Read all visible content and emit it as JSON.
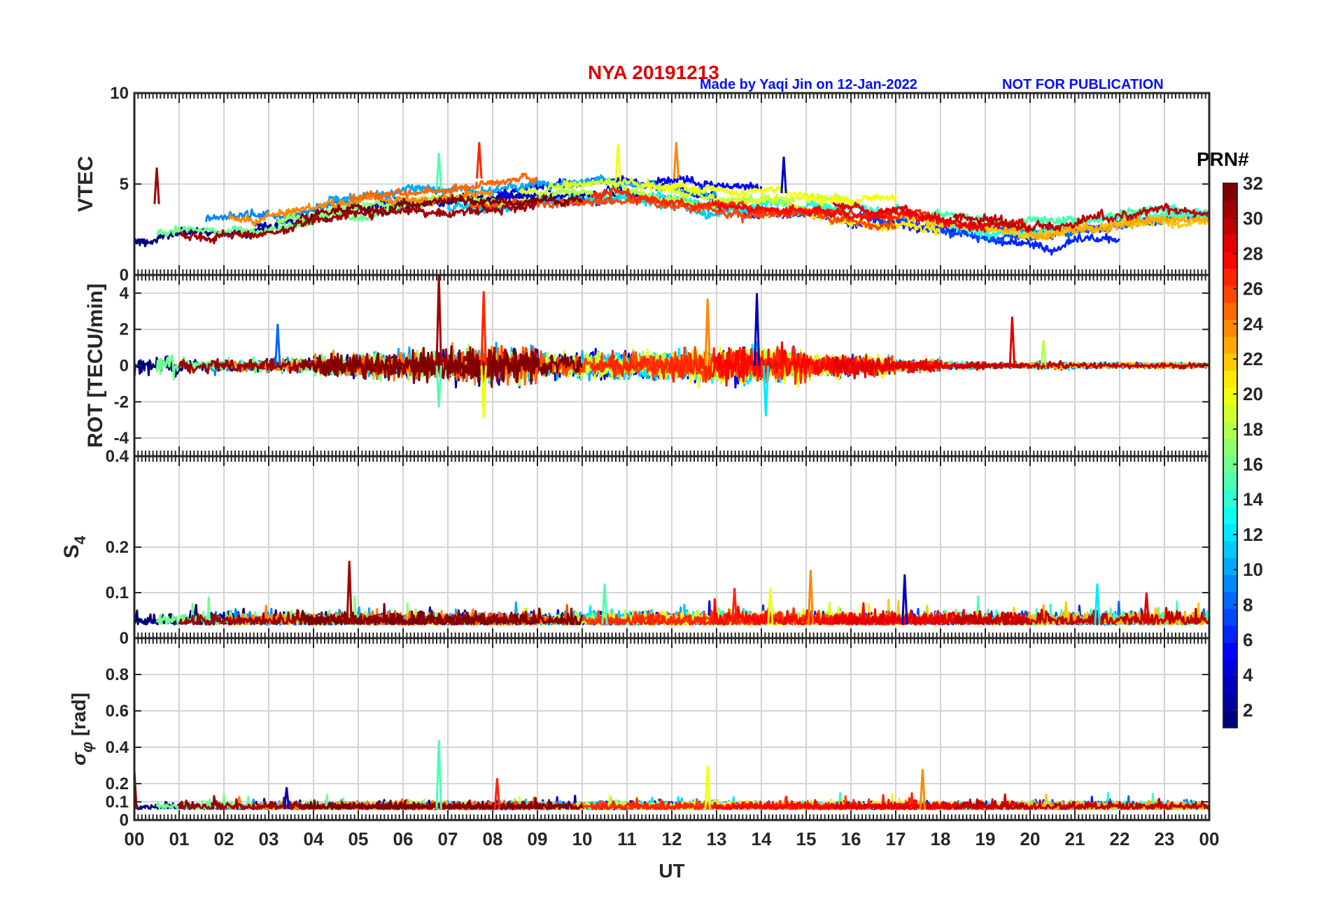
{
  "header": {
    "station": "NYA   20191213",
    "made_by": "Made by Yaqi Jin on 12-Jan-2022",
    "notice": "NOT FOR PUBLICATION"
  },
  "colorbar": {
    "title": "PRN#",
    "colormap": "jet",
    "range": [
      1,
      32
    ],
    "tick_labels": [
      "2",
      "4",
      "6",
      "8",
      "10",
      "12",
      "14",
      "16",
      "18",
      "20",
      "22",
      "24",
      "26",
      "28",
      "30",
      "32"
    ]
  },
  "chart_data": [
    {
      "type": "line",
      "panel": "VTEC",
      "ylabel": "VTEC",
      "ylim": [
        0,
        10
      ],
      "yticks": [
        0,
        5,
        10
      ],
      "ytick_labels": [
        "0",
        "5",
        "10"
      ],
      "xlim": [
        0,
        24
      ],
      "grid": true,
      "baseline_by_hour": [
        2.5,
        2.8,
        2.9,
        3.0,
        3.4,
        3.8,
        4.0,
        4.2,
        4.3,
        4.5,
        4.6,
        4.6,
        4.3,
        4.0,
        3.9,
        3.8,
        3.6,
        3.4,
        2.9,
        2.5,
        2.4,
        2.6,
        2.8,
        3.0,
        3.0
      ],
      "spikes": [
        [
          0.5,
          5.9
        ],
        [
          6.8,
          6.7
        ],
        [
          7.7,
          7.3
        ],
        [
          10.8,
          7.2
        ],
        [
          12.1,
          7.3
        ],
        [
          14.5,
          6.5
        ]
      ]
    },
    {
      "type": "line",
      "panel": "ROT",
      "ylabel": "ROT [TECU/min]",
      "ylim": [
        -5,
        5
      ],
      "yticks": [
        -4,
        -2,
        0,
        2,
        4
      ],
      "ytick_labels": [
        "-4",
        "-2",
        "0",
        "2",
        "4"
      ],
      "xlim": [
        0,
        24
      ],
      "grid": true,
      "amplitude_by_hour": [
        0.6,
        0.4,
        0.35,
        0.4,
        0.6,
        0.7,
        0.8,
        1.0,
        0.9,
        0.7,
        0.7,
        0.7,
        0.9,
        1.0,
        0.9,
        0.6,
        0.5,
        0.35,
        0.2,
        0.15,
        0.2,
        0.15,
        0.15,
        0.15,
        0.15
      ],
      "spikes": [
        [
          6.8,
          5.0
        ],
        [
          6.8,
          -2.3
        ],
        [
          7.8,
          4.1
        ],
        [
          7.8,
          -2.9
        ],
        [
          12.8,
          3.7
        ],
        [
          13.9,
          4.0
        ],
        [
          14.1,
          -2.8
        ],
        [
          19.6,
          2.7
        ],
        [
          3.2,
          2.3
        ],
        [
          20.3,
          1.4
        ]
      ]
    },
    {
      "type": "line",
      "panel": "S4",
      "ylabel": "S4",
      "ylim": [
        0,
        0.4
      ],
      "yticks": [
        0,
        0.1,
        0.2,
        0.4
      ],
      "ytick_labels": [
        "0",
        "0.1",
        "0.2",
        "0.4"
      ],
      "xlim": [
        0,
        24
      ],
      "grid": true,
      "baseline": 0.03,
      "noise": 0.02,
      "spikes": [
        [
          4.8,
          0.17
        ],
        [
          10.5,
          0.12
        ],
        [
          13.4,
          0.11
        ],
        [
          14.2,
          0.11
        ],
        [
          15.1,
          0.15
        ],
        [
          17.2,
          0.14
        ],
        [
          21.5,
          0.12
        ],
        [
          22.6,
          0.1
        ]
      ]
    },
    {
      "type": "line",
      "panel": "sigma_phi",
      "ylabel": "σ",
      "ylabel_subscript": "φ",
      "ylabel_unit": "[rad]",
      "ylim": [
        0,
        1
      ],
      "yticks": [
        0,
        0.1,
        0.2,
        0.4,
        0.6,
        0.8
      ],
      "ytick_labels": [
        "0",
        "0.1",
        "0.2",
        "0.4",
        "0.6",
        "0.8"
      ],
      "xlim": [
        0,
        24
      ],
      "xlabel": "UT",
      "xtick_labels": [
        "00",
        "01",
        "02",
        "03",
        "04",
        "05",
        "06",
        "07",
        "08",
        "09",
        "10",
        "11",
        "12",
        "13",
        "14",
        "15",
        "16",
        "17",
        "18",
        "19",
        "20",
        "21",
        "22",
        "23",
        "00"
      ],
      "grid": true,
      "baseline": 0.06,
      "noise": 0.03,
      "spikes": [
        [
          0.0,
          0.27
        ],
        [
          6.8,
          0.44
        ],
        [
          8.1,
          0.23
        ],
        [
          12.8,
          0.3
        ],
        [
          17.6,
          0.28
        ],
        [
          3.4,
          0.18
        ]
      ]
    }
  ]
}
